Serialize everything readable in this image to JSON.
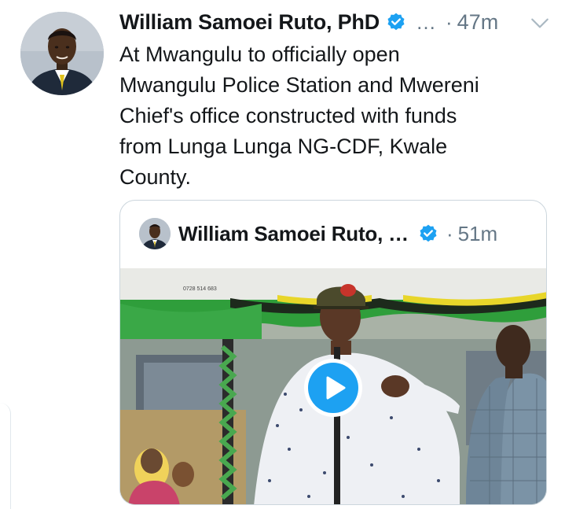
{
  "tweet": {
    "author_name": "William Samoei Ruto, PhD",
    "ellipsis": "…",
    "separator": "·",
    "time": "47m",
    "text": "At Mwangulu to officially open\nMwangulu Police Station and Mwereni\nChief's office constructed with funds\nfrom Lunga Lunga NG-CDF, Kwale\nCounty.",
    "icons": {
      "verified": "verified-badge-icon",
      "menu": "chevron-down-icon",
      "play": "play-icon"
    }
  },
  "quoted_tweet": {
    "author_name": "William Samoei Ruto, …",
    "separator": "·",
    "time": "51m",
    "media_type": "video",
    "banner_text": "0728 514 683"
  },
  "colors": {
    "accent": "#1da1f2",
    "muted_text": "#657786",
    "border": "#ccd6dd"
  }
}
